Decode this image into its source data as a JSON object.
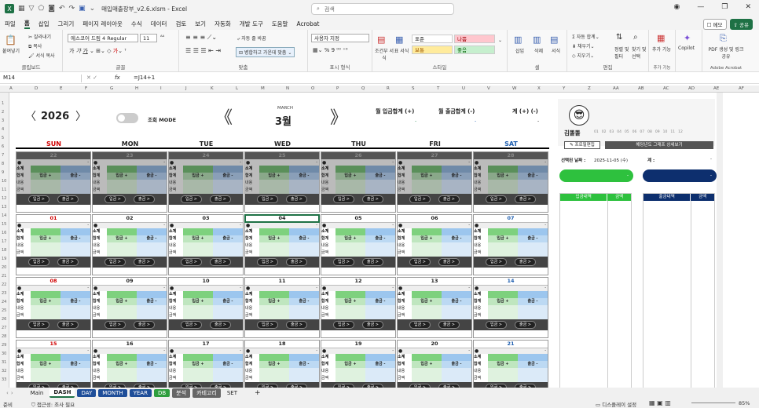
{
  "window": {
    "title": "매입매출장부_v2.6.xlsm - Excel",
    "search_placeholder": "검색"
  },
  "menu": [
    "파일",
    "홈",
    "삽입",
    "그리기",
    "페이지 레이아웃",
    "수식",
    "데이터",
    "검토",
    "보기",
    "자동화",
    "개발 도구",
    "도움말",
    "Acrobat"
  ],
  "menu_active": "홈",
  "topright": {
    "memo": "메모",
    "share": "공유"
  },
  "ribbon": {
    "paste": "붙여넣기",
    "cut": "잘라내기",
    "copy": "복사",
    "format_painter": "서식 복사",
    "clipboard": "클립보드",
    "font_name": "에스코어 드림 4 Regular",
    "font_size": "11",
    "font_group": "글꼴",
    "wrap": "자동 줄 바꿈",
    "merge": "병합하고 가운데 맞춤",
    "align_group": "맞춤",
    "number_format": "사용자 지정",
    "number_group": "표시 형식",
    "cond_format": "조건부 서식",
    "table_format": "표 서식",
    "style_normal": "표준",
    "style_bad": "나쁨",
    "style_neutral": "보통",
    "style_good": "좋음",
    "style_group": "스타일",
    "insert": "삽입",
    "delete": "삭제",
    "format": "서식",
    "cells_group": "셀",
    "autosum": "자동 합계",
    "fill": "채우기",
    "clear": "지우기",
    "sort": "정렬 및 필터",
    "find": "찾기 및 선택",
    "edit_group": "편집",
    "addins": "추가 기능",
    "addins_group": "추가 기능",
    "copilot": "Copilot",
    "pdf": "PDF 생성 및 링크 공유",
    "acrobat_group": "Adobe Acrobat"
  },
  "formula": {
    "cell_ref": "M14",
    "fx": "fx",
    "value": "=J14+1"
  },
  "columns": [
    "A",
    "D",
    "E",
    "F",
    "G",
    "H",
    "I",
    "J",
    "K",
    "L",
    "M",
    "N",
    "O",
    "P",
    "Q",
    "R",
    "S",
    "T",
    "U",
    "V",
    "W",
    "X",
    "Y",
    "Z",
    "AA",
    "AB",
    "AC",
    "AD",
    "AE",
    "AF"
  ],
  "calendar": {
    "year": "2026",
    "toggle_label": "조회 MODE",
    "month_en": "MARCH",
    "month": "3월",
    "sum_in": "월 입금합계 (+)",
    "sum_out": "월 출금합계 (-)",
    "sum_total": "계 (+) (-)",
    "sum_in_val": "-",
    "sum_out_val": "-",
    "sum_total_val": "-",
    "days": [
      "SUN",
      "MON",
      "TUE",
      "WED",
      "THU",
      "FRI",
      "SAT"
    ],
    "day_colors": [
      "#d00000",
      "#222222",
      "#222222",
      "#222222",
      "#222222",
      "#222222",
      "#1f5fb0"
    ],
    "row_labels": {
      "sub": "소계",
      "sum": "합계",
      "in": "입금 +",
      "out": "출금 -",
      "note": "내용",
      "amt": "금액",
      "btn_in": "입금 >",
      "btn_out": "출금 >"
    },
    "weeks": [
      [
        "22",
        "23",
        "24",
        "25",
        "26",
        "27",
        "28"
      ],
      [
        "01",
        "02",
        "03",
        "04",
        "05",
        "06",
        "07"
      ],
      [
        "08",
        "09",
        "10",
        "11",
        "12",
        "13",
        "14"
      ],
      [
        "15",
        "16",
        "17",
        "18",
        "19",
        "20",
        "21"
      ]
    ]
  },
  "side": {
    "user": "김똘똘",
    "profile_edit": "프로필편집",
    "chart_btn": "해당년도 그래프 상세보기",
    "months": [
      "01",
      "02",
      "03",
      "04",
      "05",
      "06",
      "07",
      "08",
      "09",
      "10",
      "11",
      "12"
    ],
    "date_label": "선택된 날짜 :",
    "date_value": "2025-11-05 (수)",
    "total_label": "계 :",
    "total_value": "-",
    "in_value": "-",
    "out_value": "-",
    "in_head": "입금내역",
    "out_head": "출금내역",
    "amt_head": "금액"
  },
  "tabs": [
    {
      "label": "Main",
      "bg": "#f0f0f0",
      "fg": "#222"
    },
    {
      "label": "DASH",
      "bg": "#ffffff",
      "fg": "#222"
    },
    {
      "label": "DAY",
      "bg": "#1f4e99",
      "fg": "#fff"
    },
    {
      "label": "MONTH",
      "bg": "#1f4e99",
      "fg": "#fff"
    },
    {
      "label": "YEAR",
      "bg": "#1f4e99",
      "fg": "#fff"
    },
    {
      "label": "DB",
      "bg": "#2e9e3e",
      "fg": "#fff"
    },
    {
      "label": "분석",
      "bg": "#666666",
      "fg": "#fff"
    },
    {
      "label": "카테고리",
      "bg": "#666666",
      "fg": "#fff"
    },
    {
      "label": "SET",
      "bg": "#f0f0f0",
      "fg": "#222"
    }
  ],
  "status": {
    "ready": "준비",
    "access": "접근성: 조사 필요",
    "display": "디스플레이 설정",
    "zoom": "85%"
  }
}
